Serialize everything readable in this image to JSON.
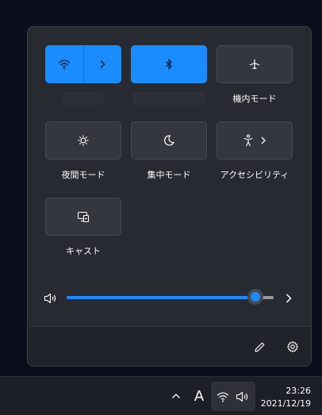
{
  "quick_settings": {
    "tiles": [
      {
        "id": "wifi",
        "icon": "wifi-icon",
        "label": "",
        "active": true,
        "has_chevron": true
      },
      {
        "id": "bluetooth",
        "icon": "bluetooth-icon",
        "label": "",
        "active": true,
        "has_chevron": false
      },
      {
        "id": "airplane",
        "icon": "airplane-icon",
        "label": "機内モード",
        "active": false,
        "has_chevron": false
      },
      {
        "id": "night_light",
        "icon": "brightness-icon",
        "label": "夜間モード",
        "active": false,
        "has_chevron": false
      },
      {
        "id": "focus",
        "icon": "moon-icon",
        "label": "集中モード",
        "active": false,
        "has_chevron": false
      },
      {
        "id": "accessibility",
        "icon": "accessibility-icon",
        "label": "アクセシビリティ",
        "active": false,
        "has_chevron": true
      },
      {
        "id": "cast",
        "icon": "cast-icon",
        "label": "キャスト",
        "active": false,
        "has_chevron": false
      }
    ],
    "volume": {
      "level": 0.91,
      "icon": "speaker-icon"
    },
    "footer": {
      "edit_icon": "pencil-icon",
      "settings_icon": "gear-icon"
    }
  },
  "taskbar": {
    "ime_indicator": "A",
    "time": "23:26",
    "date": "2021/12/19"
  },
  "colors": {
    "accent": "#1a8cff",
    "panel": "#272a31",
    "tile": "#34373d",
    "desktop": "#0b0f1c"
  }
}
